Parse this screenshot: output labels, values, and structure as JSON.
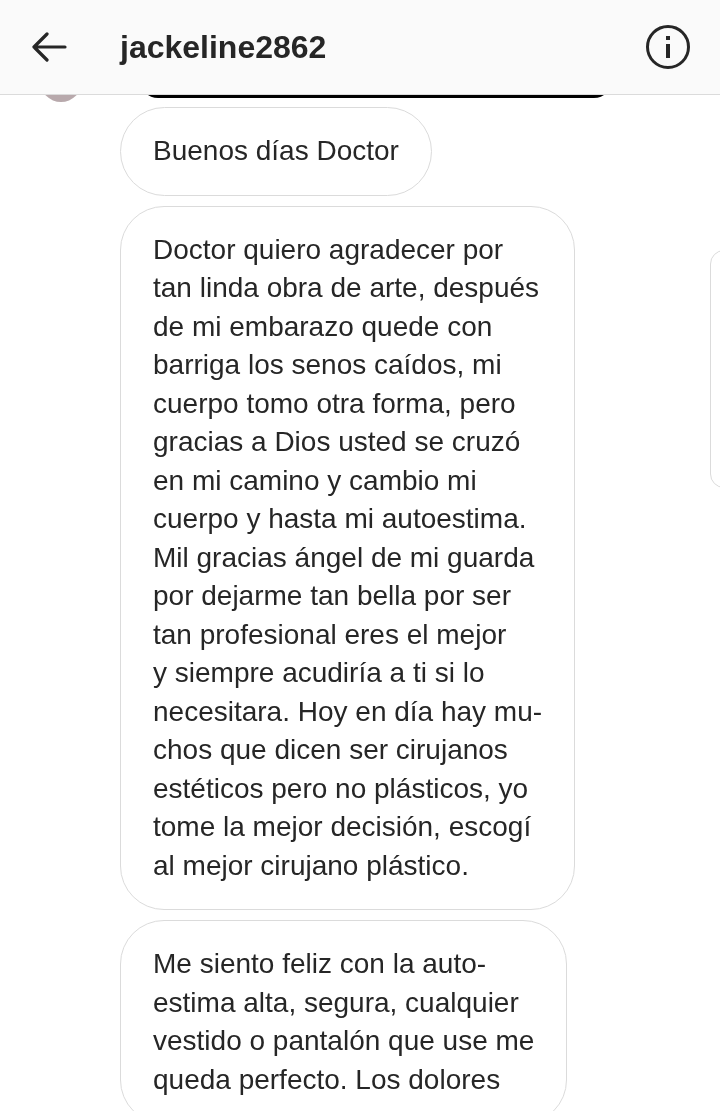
{
  "header": {
    "title": "jackeline2862"
  },
  "messages": [
    {
      "lines": [
        "Buenos días Doctor"
      ]
    },
    {
      "lines": [
        "Doctor quiero agradecer por",
        "tan linda obra de arte, después",
        "de mi embarazo quede con",
        "barriga los senos caídos, mi",
        "cuerpo tomo otra forma, pero",
        "gracias a Dios usted se cruzó",
        "en mi camino y cambio mi",
        "cuerpo y hasta mi autoestima.",
        "Mil gracias ángel de mi guarda",
        "por dejarme tan bella por ser",
        "tan profesional eres el mejor",
        "y siempre acudiría a ti si lo",
        "necesitara. Hoy en día hay mu-",
        "chos que dicen ser cirujanos",
        "estéticos pero no plásticos, yo",
        "tome la mejor decisión, escogí",
        "al mejor cirujano plástico."
      ]
    },
    {
      "lines": [
        "Me siento feliz con la auto-",
        "estima alta, segura, cualquier",
        "vestido o pantalón que use me",
        "queda perfecto. Los dolores"
      ]
    }
  ]
}
